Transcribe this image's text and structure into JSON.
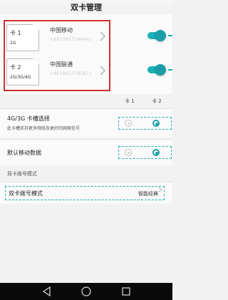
{
  "header": {
    "title": "双卡管理"
  },
  "sims": [
    {
      "slot_label": "卡 1",
      "network": "2G",
      "carrier": "中国移动",
      "number": "+8613957184401",
      "enabled": true
    },
    {
      "slot_label": "卡 2",
      "network": "2G/3G/4G",
      "carrier": "中国联通",
      "number": "+8618627785672",
      "enabled": true
    }
  ],
  "columns": {
    "card1": "卡 1",
    "card2": "卡 2"
  },
  "settings": {
    "slot_select": {
      "title": "4G/3G 卡槽选择",
      "subtitle": "此卡槽支持更多频段及更好的网络信号",
      "selected": "卡 2"
    },
    "default_data": {
      "title": "默认移动数据",
      "selected": "卡 2"
    }
  },
  "dial_section": {
    "header": "双卡拨号模式",
    "label": "双卡拨号模式",
    "value": "智能经典"
  },
  "icons": [
    "sim-card-icon",
    "chevron-right-icon",
    "back-icon",
    "home-icon",
    "recent-apps-icon"
  ],
  "colors": {
    "accent": "#1cb0b8",
    "highlight": "#d32f2f",
    "nav_bar": "#0a0a0a"
  }
}
